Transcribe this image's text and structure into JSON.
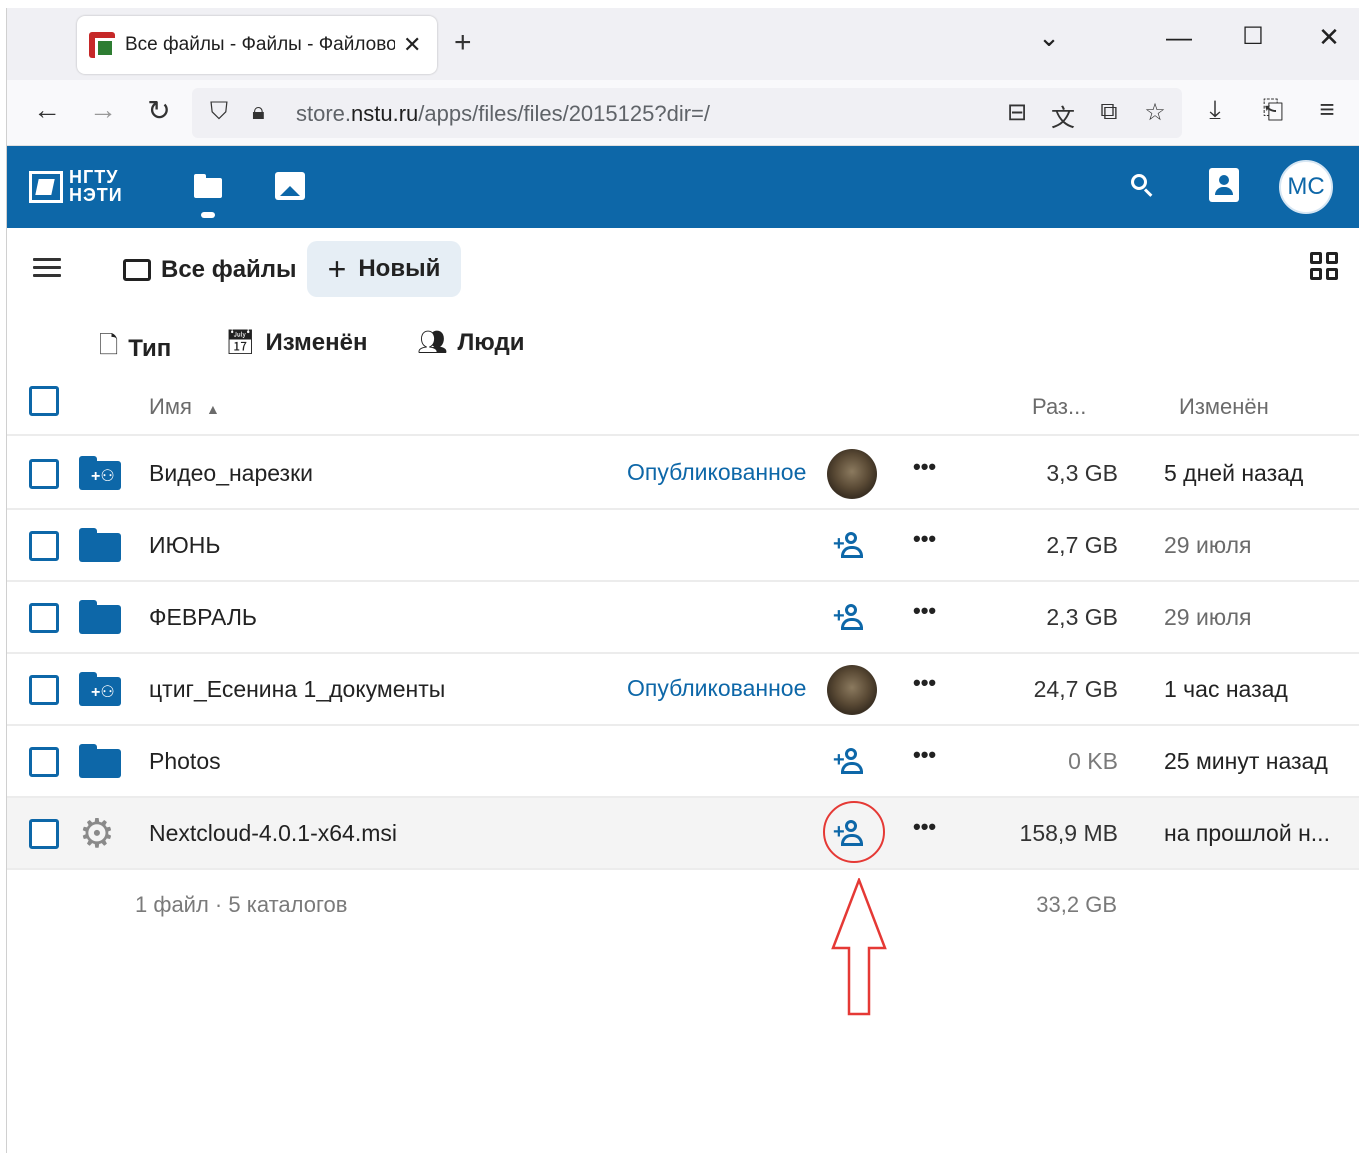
{
  "browser": {
    "tab_title": "Все файлы - Файлы - Файлово",
    "tab_close": "✕",
    "new_tab": "+",
    "window": {
      "dropdown": "⌄",
      "minimize": "—",
      "maximize": "☐",
      "close": "✕"
    },
    "nav": {
      "back": "←",
      "forward": "→",
      "reload": "↻"
    },
    "url_prefix": "store.",
    "url_host": "nstu.ru",
    "url_path": "/apps/files/files/2015125?dir=/"
  },
  "app": {
    "logo_line1": "НГТУ",
    "logo_line2": "НЭТИ",
    "user_initials": "MC",
    "accent_color": "#0d67a8"
  },
  "toolbar": {
    "breadcrumb": "Все файлы",
    "new_label": "Новый",
    "new_plus": "+"
  },
  "filters": {
    "type": "Тип",
    "modified": "Изменён",
    "people": "Люди"
  },
  "table": {
    "headers": {
      "name": "Имя",
      "size": "Раз...",
      "modified": "Изменён"
    },
    "rows": [
      {
        "name": "Видео_нарезки",
        "status": "Опубликованное",
        "size": "3,3 GB",
        "modified": "5 дней назад"
      },
      {
        "name": "ИЮНЬ",
        "size": "2,7 GB",
        "modified": "29 июля"
      },
      {
        "name": "ФЕВРАЛЬ",
        "size": "2,3 GB",
        "modified": "29 июля"
      },
      {
        "name": "цтиг_Есенина 1_документы",
        "status": "Опубликованное",
        "size": "24,7 GB",
        "modified": "1 час назад"
      },
      {
        "name": "Photos",
        "size": "0 KB",
        "modified": "25 минут назад"
      },
      {
        "name": "Nextcloud-4.0.1-x64.msi",
        "size": "158,9 MB",
        "modified": "на прошлой н..."
      }
    ],
    "more": "•••",
    "summary": "1 файл · 5 каталогов",
    "total_size": "33,2 GB"
  }
}
